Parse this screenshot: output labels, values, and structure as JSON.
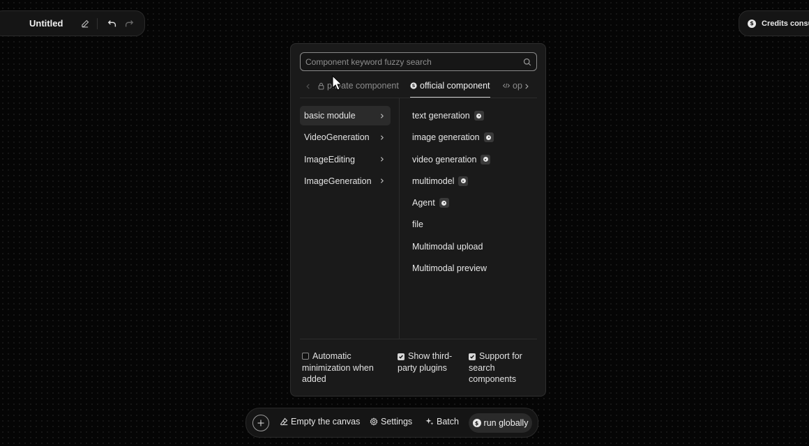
{
  "header": {
    "title": "Untitled",
    "edit_icon": "pencil-icon",
    "undo_icon": "undo-icon",
    "redo_icon": "redo-icon"
  },
  "credits": {
    "label": "Credits consum",
    "icon": "coin-icon"
  },
  "panel": {
    "search": {
      "placeholder": "Component keyword fuzzy search",
      "value": ""
    },
    "tabs": [
      {
        "label": "private component",
        "icon": "lock-icon",
        "active": false
      },
      {
        "label": "official component",
        "icon": "official-icon",
        "active": true
      },
      {
        "label": "op",
        "icon": "code-icon",
        "active": false
      }
    ],
    "categories": [
      {
        "label": "basic module",
        "active": true
      },
      {
        "label": "VideoGeneration",
        "active": false
      },
      {
        "label": "ImageEditing",
        "active": false
      },
      {
        "label": "ImageGeneration",
        "active": false
      }
    ],
    "components": [
      {
        "label": "text generation",
        "badge": true
      },
      {
        "label": "image generation",
        "badge": true
      },
      {
        "label": "video generation",
        "badge": true
      },
      {
        "label": "multimodel",
        "badge": true
      },
      {
        "label": "Agent",
        "badge": true
      },
      {
        "label": "file",
        "badge": false
      },
      {
        "label": "Multimodal upload",
        "badge": false
      },
      {
        "label": "Multimodal preview",
        "badge": false
      }
    ],
    "options": [
      {
        "label": "Automatic minimization when added",
        "checked": false
      },
      {
        "label": "Show third-party plugins",
        "checked": true
      },
      {
        "label": "Support for search components",
        "checked": true
      }
    ]
  },
  "toolbar": {
    "add_icon": "plus-icon",
    "empty_label": "Empty the canvas",
    "settings_label": "Settings",
    "batch_label": "Batch",
    "run_label": "run globally"
  },
  "colors": {
    "background": "#050505",
    "panel": "#1a1a1a",
    "accent_text": "#f2f2f2",
    "muted_text": "#8c8c8c"
  }
}
